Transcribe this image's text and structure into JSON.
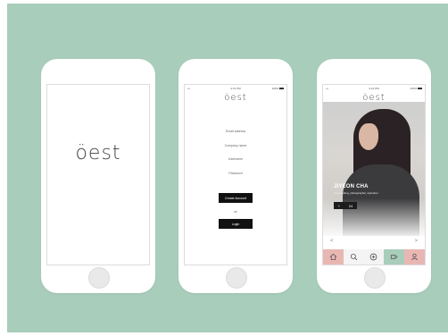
{
  "phones": {
    "splash": {
      "logo": "öest"
    },
    "login": {
      "status": {
        "carrier": "•••",
        "time": "4:21 PM",
        "battery": "100%"
      },
      "logo": "öest",
      "fields": [
        "Email address",
        "Company name",
        "Username",
        "Password"
      ],
      "signup_label": "Create Account",
      "or_label": "or",
      "login_label": "Login"
    },
    "profile": {
      "status": {
        "carrier": "•••",
        "time": "4:21 PM",
        "battery": "100%"
      },
      "logo": "öest",
      "name": "JIYEON CHA",
      "subtitle": "Interiortaling, photographer, stylodoor",
      "follow_plus": "+",
      "follow_count": "24",
      "prev_arrow": "<",
      "next_arrow": ">",
      "tabs": [
        "home",
        "search",
        "add",
        "tag",
        "profile"
      ]
    }
  },
  "colors": {
    "background": "#a8cdbb",
    "tab_pink": "#e9b7b3",
    "tab_green": "#a8cdbb"
  }
}
